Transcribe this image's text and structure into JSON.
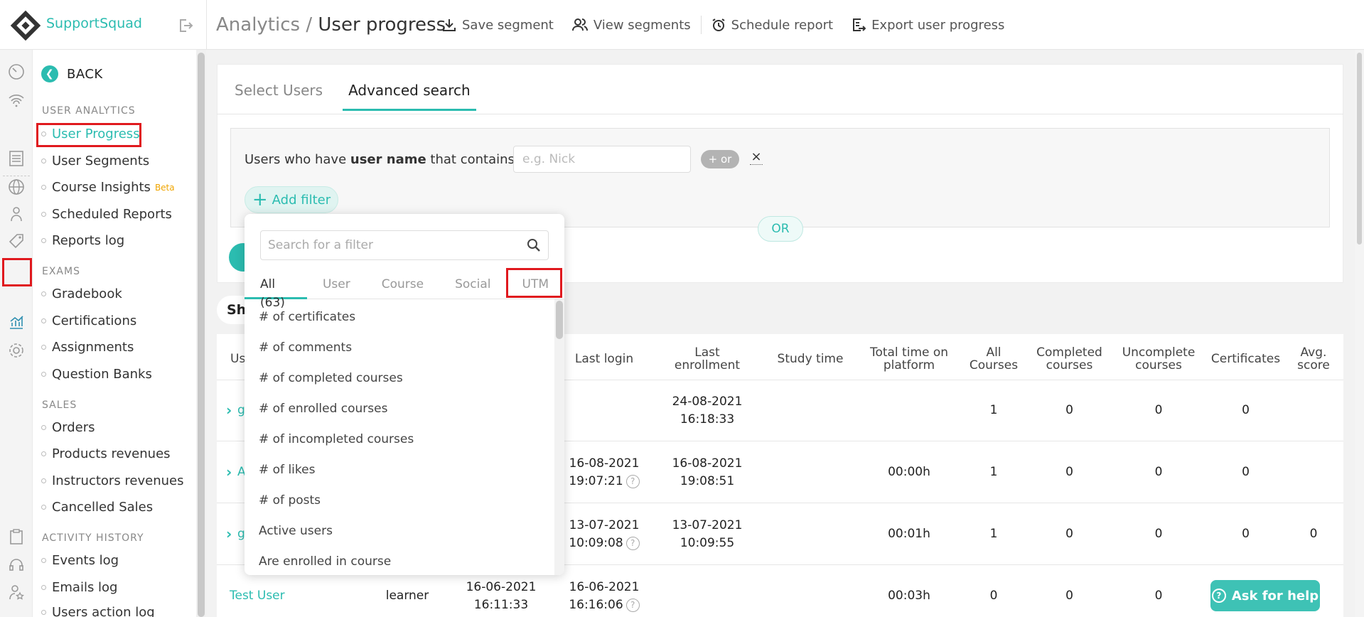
{
  "app": {
    "brand": "SupportSquad"
  },
  "header": {
    "crumb": "Analytics",
    "separator": " / ",
    "title": "User progress",
    "actions": {
      "save_segment": "Save segment",
      "view_segments": "View segments",
      "schedule_report": "Schedule report",
      "export": "Export user progress"
    }
  },
  "sidebar": {
    "back": "BACK",
    "sections": {
      "user_analytics": "USER ANALYTICS",
      "exams": "EXAMS",
      "sales": "SALES",
      "activity_history": "ACTIVITY HISTORY"
    },
    "items": {
      "user_progress": "User Progress",
      "user_segments": "User Segments",
      "course_insights": "Course Insights",
      "beta": "Beta",
      "scheduled_reports": "Scheduled Reports",
      "reports_log": "Reports log",
      "gradebook": "Gradebook",
      "certifications": "Certifications",
      "assignments": "Assignments",
      "question_banks": "Question Banks",
      "orders": "Orders",
      "products_revenues": "Products revenues",
      "instructors_revenues": "Instructors revenues",
      "cancelled_sales": "Cancelled Sales",
      "events_log": "Events log",
      "emails_log": "Emails log",
      "users_action_log": "Users action log"
    }
  },
  "search_panel": {
    "tabs": {
      "select_users": "Select Users",
      "advanced_search": "Advanced search"
    },
    "filter": {
      "prefix": "Users who  have ",
      "field": "user name",
      "suffix": " that contains",
      "placeholder": "e.g. Nick",
      "or_pill": "+ or",
      "remove": "×"
    },
    "add_filter": "Add filter",
    "or_bubble": "OR"
  },
  "dropdown": {
    "search_placeholder": "Search for a filter",
    "tabs": {
      "all": "All (63)",
      "user": "User",
      "course": "Course",
      "social": "Social",
      "utm": "UTM"
    },
    "items": [
      "# of certificates",
      "# of comments",
      "# of completed courses",
      "# of enrolled courses",
      "# of incompleted courses",
      "# of likes",
      "# of posts",
      "Active users",
      "Are enrolled in course"
    ]
  },
  "table": {
    "show_label": "Sh",
    "columns": {
      "user": "Us",
      "last_login": "Last login",
      "last_enrollment": "Last enrollment",
      "study_time": "Study time",
      "total_time": "Total time on platform",
      "all_courses": "All Courses",
      "completed": "Completed courses",
      "uncomplete": "Uncomplete courses",
      "certificates": "Certificates",
      "avg_score": "Avg. score"
    },
    "rows": [
      {
        "user": "g",
        "role": "",
        "reg_date": "",
        "reg_time": "",
        "login_date": "",
        "login_time": "",
        "enroll_date": "24-08-2021",
        "enroll_time": "16:18:33",
        "total": "",
        "all": "1",
        "completed": "0",
        "uncomplete": "0",
        "certificates": "0",
        "avg": ""
      },
      {
        "user": "A",
        "role": "",
        "reg_date": "",
        "reg_time": "",
        "login_date": "16-08-2021",
        "login_time": "19:07:21",
        "enroll_date": "16-08-2021",
        "enroll_time": "19:08:51",
        "total": "00:00h",
        "all": "1",
        "completed": "0",
        "uncomplete": "0",
        "certificates": "0",
        "avg": ""
      },
      {
        "user": "g",
        "role": "",
        "reg_date": "",
        "reg_time": "",
        "login_date": "13-07-2021",
        "login_time": "10:09:08",
        "enroll_date": "13-07-2021",
        "enroll_time": "10:09:55",
        "total": "00:01h",
        "all": "1",
        "completed": "0",
        "uncomplete": "0",
        "certificates": "0",
        "avg": "0"
      },
      {
        "user": "Test User",
        "role": "learner",
        "reg_date": "16-06-2021",
        "reg_time": "16:11:33",
        "login_date": "16-06-2021",
        "login_time": "16:16:06",
        "enroll_date": "",
        "enroll_time": "",
        "total": "00:03h",
        "all": "0",
        "completed": "0",
        "uncomplete": "0",
        "certificates": "",
        "avg": ""
      }
    ],
    "help_icon": "?"
  },
  "help_button": {
    "label": "Ask for help",
    "icon": "?"
  },
  "colors": {
    "accent": "#2bbcb0",
    "highlight": "#e0191e",
    "beta": "#f0a500"
  }
}
